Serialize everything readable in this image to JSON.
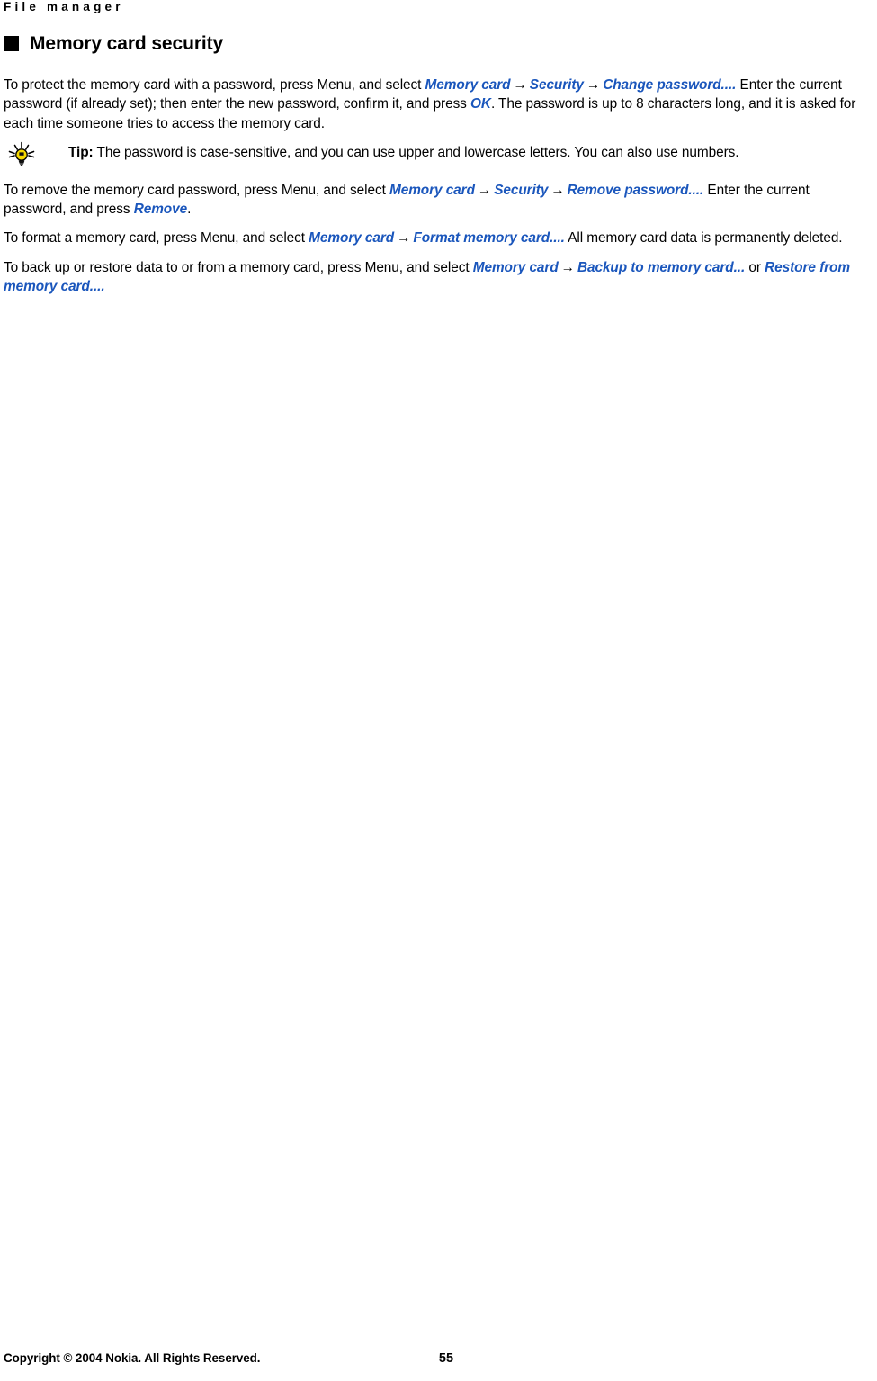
{
  "document": {
    "running_header": "File manager",
    "heading": "Memory card security",
    "heading_bullet_icon": "filled-square-bullet",
    "link_color": "#1a56bc",
    "text_color": "#000000",
    "background_color": "#ffffff"
  },
  "paragraphs": {
    "p1": {
      "seg1": "To protect the memory card with a password, press Menu, and select ",
      "link1": "Memory card",
      "arrow1": "→",
      "link2": "Security",
      "arrow2": "→",
      "link3": "Change password....",
      "seg2": " Enter the current password (if already set); then enter the new password, confirm it, and press ",
      "link4": "OK",
      "seg3": ". The password is up to 8 characters long, and it is asked for each time someone tries to access the memory card."
    },
    "p2": {
      "seg1": "To remove the memory card password, press Menu, and select ",
      "link1": "Memory card",
      "arrow1": "→",
      "link2": "Security",
      "arrow2": "→",
      "link3": "Remove password....",
      "seg2": " Enter the current password, and press ",
      "link4": "Remove",
      "seg3": "."
    },
    "p3": {
      "seg1": "To format a memory card, press Menu, and select ",
      "link1": "Memory card",
      "arrow1": "→",
      "link2": "Format memory card....",
      "seg2": " All memory card data is permanently deleted."
    },
    "p4": {
      "seg1": "To back up or restore data to or from a memory card, press Menu, and select ",
      "link1": "Memory card",
      "arrow1": "→",
      "link2": "Backup to memory card...",
      "seg2": " or ",
      "link3": "Restore from memory card....",
      "seg3": ""
    }
  },
  "tip": {
    "icon": "lightbulb-icon",
    "label": "Tip:",
    "text": " The password is case-sensitive, and you can use upper and lowercase letters. You can also use numbers."
  },
  "footer": {
    "copyright": "Copyright © 2004 Nokia. All Rights Reserved.",
    "page_number": "55"
  }
}
